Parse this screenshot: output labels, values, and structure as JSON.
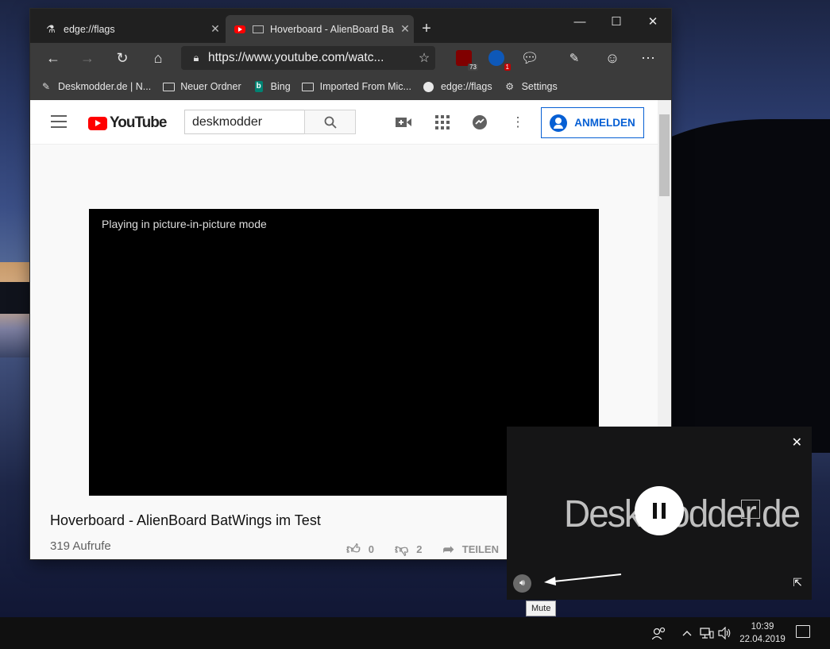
{
  "browser": {
    "tabs": [
      {
        "label": "edge://flags",
        "icon": "flask-icon"
      },
      {
        "label": "Hoverboard - AlienBoard Ba",
        "icon": "youtube-icon"
      }
    ],
    "address": {
      "url": "https://www.youtube.com/watc..."
    },
    "extensions": [
      {
        "name": "ublock-icon",
        "badge": "73",
        "color": "#800000"
      },
      {
        "name": "sync-icon",
        "badge": "1",
        "color": "#0e58b8"
      },
      {
        "name": "chat-icon",
        "badge": "",
        "color": "#3b3b3b"
      }
    ],
    "favorites": [
      {
        "label": "Deskmodder.de | N...",
        "icon": "brush-icon"
      },
      {
        "label": "Neuer Ordner",
        "icon": "folder-icon"
      },
      {
        "label": "Bing",
        "icon": "bing-icon"
      },
      {
        "label": "Imported From Mic...",
        "icon": "folder-icon"
      },
      {
        "label": "edge://flags",
        "icon": "globe-icon"
      },
      {
        "label": "Settings",
        "icon": "gear-icon"
      }
    ]
  },
  "youtube": {
    "logo_text": "YouTube",
    "search_value": "deskmodder",
    "signin_label": "ANMELDEN",
    "pip_message": "Playing in picture-in-picture mode",
    "video_title": "Hoverboard - AlienBoard BatWings im Test",
    "views": "319 Aufrufe",
    "likes": "0",
    "dislikes": "2",
    "share_label": "TEILEN"
  },
  "pip": {
    "brand_text": "Deskmodder.de",
    "tooltip": "Mute"
  },
  "taskbar": {
    "time": "10:39",
    "date": "22.04.2019"
  }
}
